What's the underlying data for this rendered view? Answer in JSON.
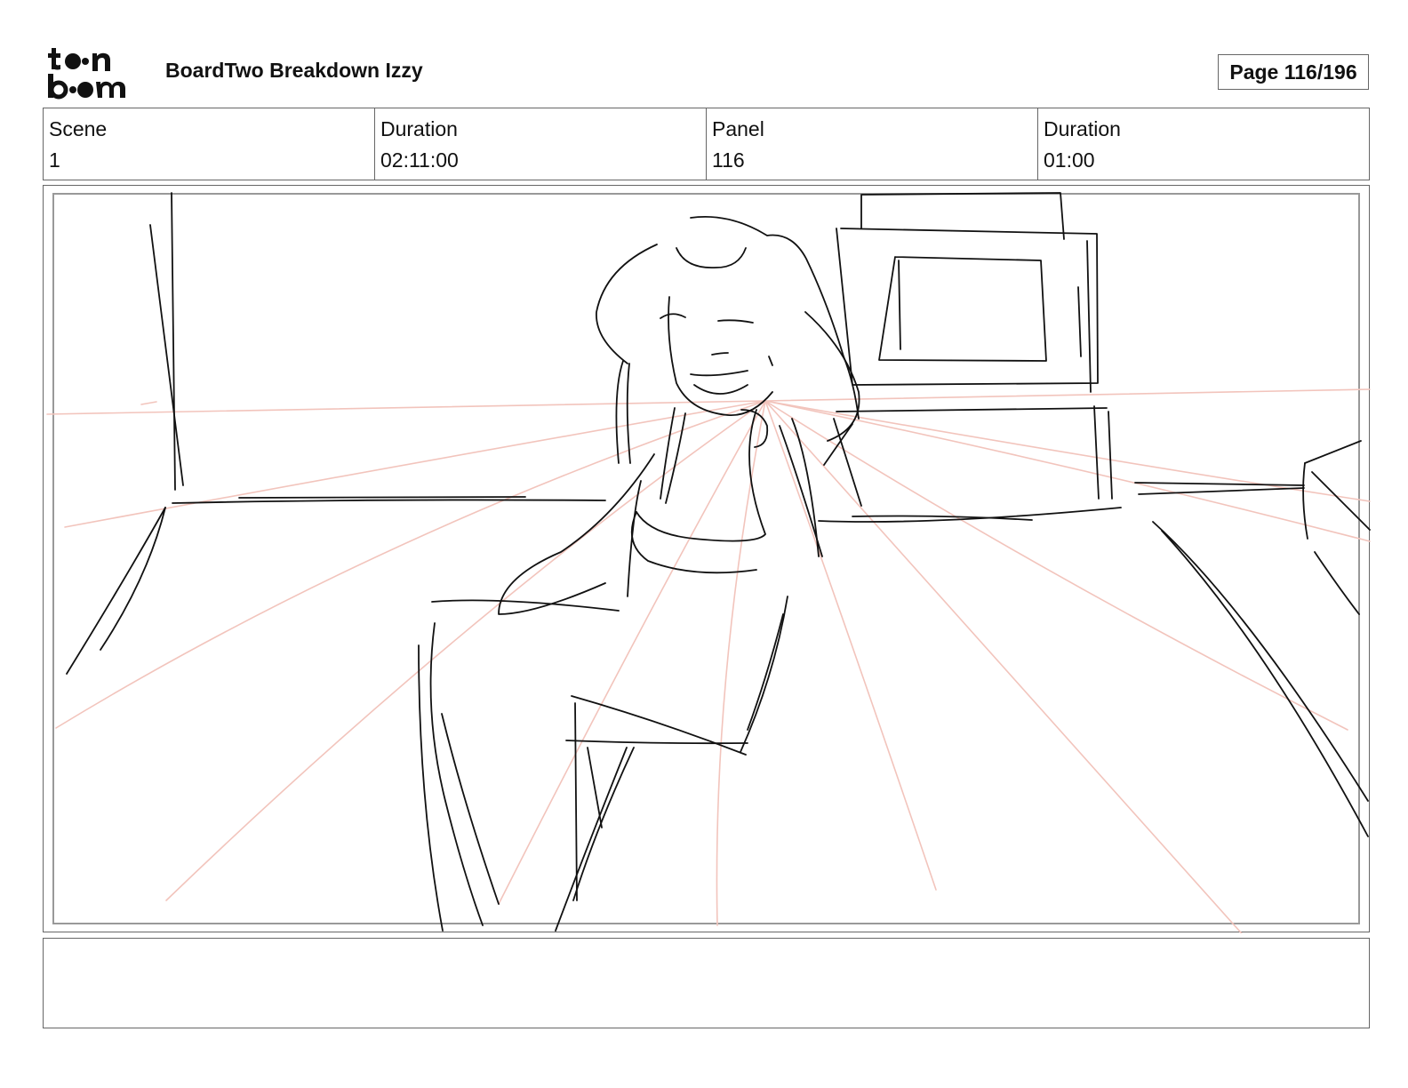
{
  "header": {
    "logo_text": "toon boom",
    "project_title": "BoardTwo Breakdown Izzy",
    "page_label": "Page 116/196"
  },
  "info": {
    "scene_label": "Scene",
    "scene_value": "1",
    "scene_duration_label": "Duration",
    "scene_duration_value": "02:11:00",
    "panel_label": "Panel",
    "panel_value": "116",
    "panel_duration_label": "Duration",
    "panel_duration_value": "01:00"
  },
  "notes": {
    "text": ""
  },
  "colors": {
    "perspective_lines": "#f2c4bc",
    "sketch_lines": "#111111",
    "border": "#666666"
  }
}
